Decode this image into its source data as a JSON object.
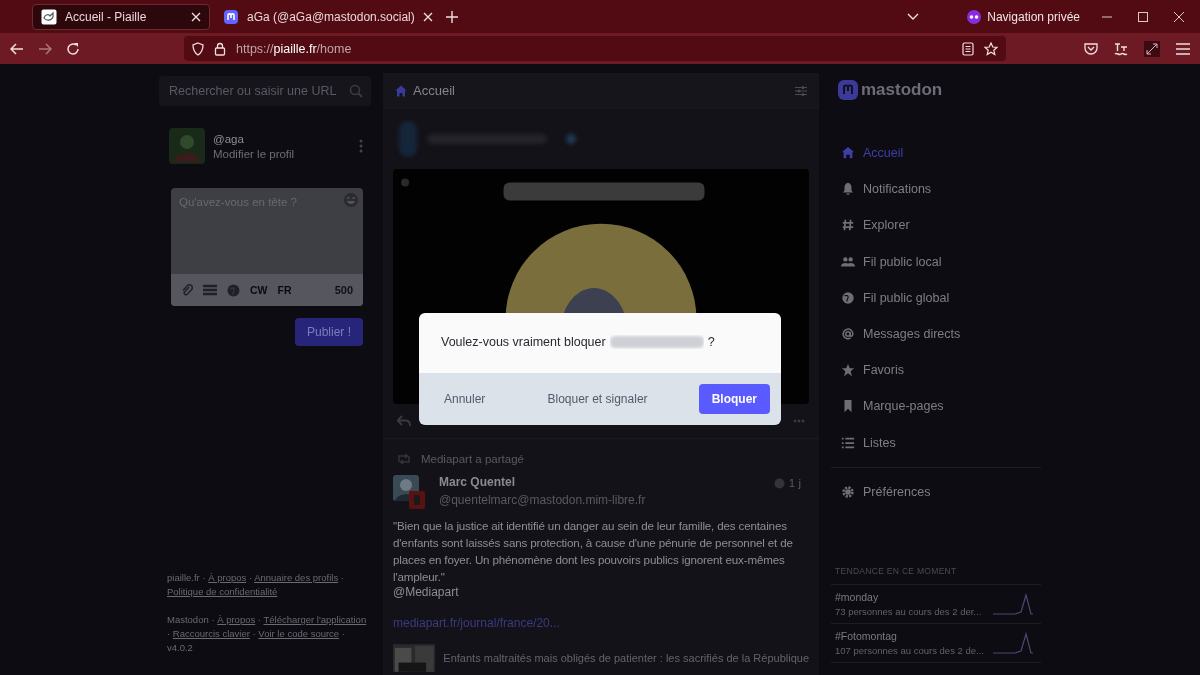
{
  "browser": {
    "tabs": [
      {
        "title": "Accueil - Piaille",
        "selected": true
      },
      {
        "title": "aGa (@aGa@mastodon.social)",
        "selected": false
      }
    ],
    "private_label": "Navigation privée",
    "url": {
      "scheme": "https://",
      "host": "piaille.fr",
      "path": "/home"
    }
  },
  "search": {
    "placeholder": "Rechercher ou saisir une URL"
  },
  "profile": {
    "handle": "@aga",
    "edit_link": "Modifier le profil"
  },
  "composer": {
    "placeholder": "Qu'avez-vous en tête ?",
    "cw": "CW",
    "language": "FR",
    "counter": "500",
    "publish": "Publier !"
  },
  "footer": {
    "separator": "·",
    "groups": [
      {
        "items": [
          {
            "text": "piaille.fr",
            "link": false
          },
          {
            "text": "À propos",
            "link": true
          },
          {
            "text": "Annuaire des profils",
            "link": true
          },
          {
            "text": "Politique de confidentialité",
            "link": true
          }
        ]
      },
      {
        "items": [
          {
            "text": "Mastodon",
            "link": false
          },
          {
            "text": "À propos",
            "link": true
          },
          {
            "text": "Télécharger l'application",
            "link": true
          },
          {
            "text": "Raccourcis clavier",
            "link": true
          },
          {
            "text": "Voir le code source",
            "link": true
          },
          {
            "text": "v4.0.2",
            "link": false
          }
        ]
      }
    ]
  },
  "timeline": {
    "title": "Accueil",
    "statuses": [
      {
        "kind": "media"
      },
      {
        "kind": "boost",
        "boosted_by": "Mediapart a partagé",
        "author": "Marc Quentel",
        "handle": "@quentelmarc@mastodon.mim-libre.fr",
        "time": "1 j",
        "content": "\"Bien que la justice ait identifié un danger au sein de leur famille, des centaines d'enfants sont laissés sans protection, à cause d'une pénurie de personnel et de places en foyer. Un phénomène dont les pouvoirs publics ignorent eux-mêmes l'ampleur.\"",
        "mention": "@Mediapart",
        "link": "mediapart.fr/journal/france/20...",
        "card_title": "Enfants maltraités mais obligés de patienter : les sacrifiés de la République"
      }
    ]
  },
  "sidebar": {
    "logo": "mastodon",
    "items": [
      {
        "label": "Accueil",
        "selected": true
      },
      {
        "label": "Notifications",
        "selected": false
      },
      {
        "label": "Explorer",
        "selected": false
      },
      {
        "label": "Fil public local",
        "selected": false
      },
      {
        "label": "Fil public global",
        "selected": false
      },
      {
        "label": "Messages directs",
        "selected": false
      },
      {
        "label": "Favoris",
        "selected": false
      },
      {
        "label": "Marque-pages",
        "selected": false
      },
      {
        "label": "Listes",
        "selected": false
      }
    ],
    "preferences": "Préférences",
    "trends_heading": "TENDANCE EN CE MOMENT",
    "trends": [
      {
        "tag": "#monday",
        "stats": "73 personnes au cours des 2 der..."
      },
      {
        "tag": "#Fotomontag",
        "stats": "107 personnes au cours des 2 de..."
      }
    ]
  },
  "dialog": {
    "message_before": "Voulez-vous vraiment bloquer",
    "message_after": "?",
    "buttons": [
      {
        "label": "Annuler",
        "kind": "link"
      },
      {
        "label": "Bloquer et signaler",
        "kind": "link"
      },
      {
        "label": "Bloquer",
        "kind": "primary"
      }
    ]
  }
}
